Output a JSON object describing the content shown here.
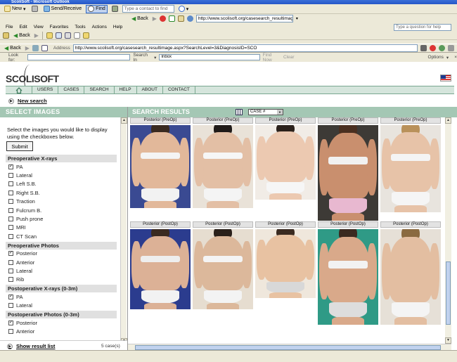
{
  "window": {
    "title": "ScoliSoft - Microsoft Outlook"
  },
  "toolbar1": {
    "new_label": "New",
    "send_receive_label": "Send/Receive",
    "find_label": "Find",
    "contact_placeholder": "Type a contact to find",
    "back_label": "Back",
    "url": "http://www.scolisoft.org/casesearch_resultimag"
  },
  "menu": {
    "items": [
      "File",
      "Edit",
      "View",
      "Favorites",
      "Tools",
      "Actions",
      "Help"
    ],
    "help_placeholder": "Type a question for help"
  },
  "toolbar3": {
    "back_label": "Back"
  },
  "addressbar": {
    "back_label": "Back",
    "address_label": "Address",
    "url": "http://www.scolisoft.org/casesearch_resultimage.aspx?SearchLevel=3&DiagnosisID=SCO"
  },
  "findbar": {
    "look_for_label": "Look for:",
    "search_in_label": "Search In",
    "search_in_value": "Inbox",
    "find_now_label": "Find Now",
    "clear_label": "Clear",
    "options_label": "Options"
  },
  "site": {
    "logo_text": "SCOLISOFT",
    "nav": [
      "USERS",
      "CASES",
      "SEARCH",
      "HELP",
      "ABOUT",
      "CONTACT"
    ],
    "new_search_label": "New search"
  },
  "left_panel": {
    "header": "SELECT IMAGES",
    "instructions": "Select the images you would like to display using the checkboxes below.",
    "submit_label": "Submit",
    "sections": [
      {
        "title": "Preoperative X-rays",
        "options": [
          {
            "label": "PA",
            "checked": true
          },
          {
            "label": "Lateral",
            "checked": false
          },
          {
            "label": "Left S.B.",
            "checked": false
          },
          {
            "label": "Right S.B.",
            "checked": false
          },
          {
            "label": "Traction",
            "checked": false
          },
          {
            "label": "Fulcrum B.",
            "checked": false
          },
          {
            "label": "Push prone",
            "checked": false
          },
          {
            "label": "MRI",
            "checked": false
          },
          {
            "label": "CT Scan",
            "checked": false
          }
        ]
      },
      {
        "title": "Preoperative Photos",
        "options": [
          {
            "label": "Posterior",
            "checked": true
          },
          {
            "label": "Anterior",
            "checked": false
          },
          {
            "label": "Lateral",
            "checked": false
          },
          {
            "label": "Rib",
            "checked": false
          }
        ]
      },
      {
        "title": "Postoperative X-rays (0-3m)",
        "options": [
          {
            "label": "PA",
            "checked": true
          },
          {
            "label": "Lateral",
            "checked": false
          }
        ]
      },
      {
        "title": "Postoperative Photos (0-3m)",
        "options": [
          {
            "label": "Posterior",
            "checked": true
          },
          {
            "label": "Anterior",
            "checked": false
          }
        ]
      }
    ],
    "show_result_list_label": "Show result list",
    "case_count": "5 case(s)"
  },
  "right_panel": {
    "header": "SEARCH RESULTS",
    "sort_select": "CASE #",
    "rows": [
      {
        "label": "Posterior (PreOp)",
        "cells": 5
      },
      {
        "label": "Posterior (PostOp)",
        "cells": 5
      }
    ]
  },
  "colors": {
    "panel_header": "#a4c7b4",
    "nav_bg": "#d5e5dc",
    "brand_accent": "#6e9e86"
  }
}
